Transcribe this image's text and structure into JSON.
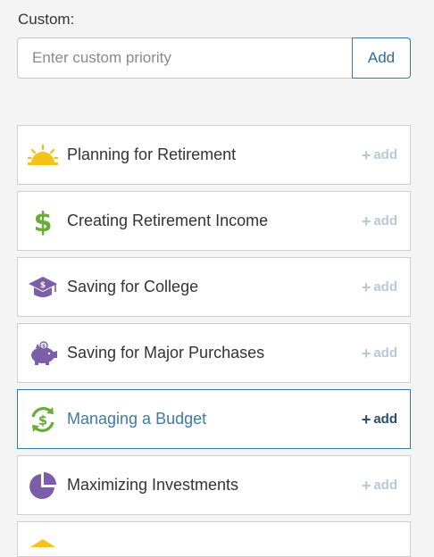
{
  "custom": {
    "label": "Custom:",
    "placeholder": "Enter custom priority",
    "add_label": "Add"
  },
  "priorities": [
    {
      "label": "Planning for Retirement",
      "icon": "sun-icon",
      "add_label": "add",
      "selected": false
    },
    {
      "label": "Creating Retirement Income",
      "icon": "dollar-icon",
      "add_label": "add",
      "selected": false
    },
    {
      "label": "Saving for College",
      "icon": "graduation-cap-icon",
      "add_label": "add",
      "selected": false
    },
    {
      "label": "Saving for Major Purchases",
      "icon": "piggy-bank-icon",
      "add_label": "add",
      "selected": false
    },
    {
      "label": "Managing a Budget",
      "icon": "recycle-dollar-icon",
      "add_label": "add",
      "selected": true
    },
    {
      "label": "Maximizing Investments",
      "icon": "pie-chart-icon",
      "add_label": "add",
      "selected": false
    }
  ],
  "colors": {
    "accent": "#3a79a6",
    "sun": "#f3c21b",
    "green": "#6aab3a",
    "purple": "#7a5fa8",
    "add_muted": "#b7c9d6"
  }
}
